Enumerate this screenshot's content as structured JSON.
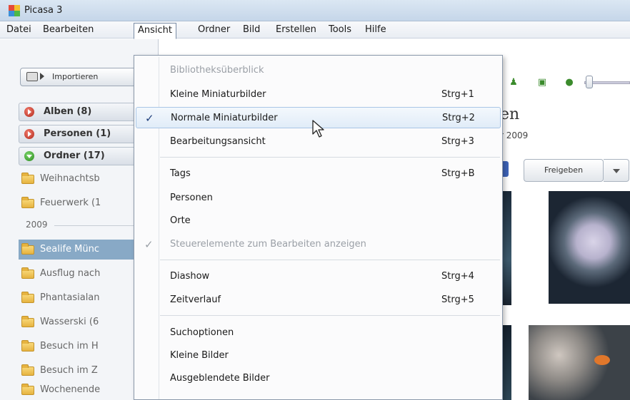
{
  "window": {
    "title": "Picasa 3"
  },
  "menubar": {
    "items": [
      "Datei",
      "Bearbeiten",
      "Ansicht",
      "Ordner",
      "Bild",
      "Erstellen",
      "Tools",
      "Hilfe"
    ]
  },
  "left_panel": {
    "import_label": "Importieren",
    "sections": [
      "Alben (8)",
      "Personen (1)",
      "Ordner (17)"
    ],
    "folders_before_year": [
      "Weihnachtsb",
      "Feuerwerk (1"
    ],
    "year": "2009",
    "folders_after_year": [
      "Sealife Münc",
      "Ausflug nach",
      "Phantasialan",
      "Wasserski (6",
      "Besuch im H",
      "Besuch im Z",
      "Wochenende"
    ],
    "selected_folder": "Sealife Münc"
  },
  "content": {
    "title_fragment": "en",
    "date_fragment": "r 2009",
    "share_label": "Freigeben"
  },
  "dropdown": {
    "items": [
      {
        "label": "Bibliotheksüberblick",
        "shortcut": "",
        "checked": false,
        "disabled": true
      },
      {
        "label": "Kleine Miniaturbilder",
        "shortcut": "Strg+1",
        "checked": false,
        "disabled": false
      },
      {
        "label": "Normale Miniaturbilder",
        "shortcut": "Strg+2",
        "checked": true,
        "disabled": false
      },
      {
        "label": "Bearbeitungsansicht",
        "shortcut": "Strg+3",
        "checked": false,
        "disabled": false
      },
      {
        "label": "Tags",
        "shortcut": "Strg+B",
        "checked": false,
        "disabled": false
      },
      {
        "label": "Personen",
        "shortcut": "",
        "checked": false,
        "disabled": false
      },
      {
        "label": "Orte",
        "shortcut": "",
        "checked": false,
        "disabled": false
      },
      {
        "label": "Steuerelemente zum Bearbeiten anzeigen",
        "shortcut": "",
        "checked": true,
        "disabled": true
      },
      {
        "label": "Diashow",
        "shortcut": "Strg+4",
        "checked": false,
        "disabled": false
      },
      {
        "label": "Zeitverlauf",
        "shortcut": "Strg+5",
        "checked": false,
        "disabled": false
      },
      {
        "label": "Suchoptionen",
        "shortcut": "",
        "checked": false,
        "disabled": false
      },
      {
        "label": "Kleine Bilder",
        "shortcut": "",
        "checked": false,
        "disabled": false
      },
      {
        "label": "Ausgeblendete Bilder",
        "shortcut": "",
        "checked": false,
        "disabled": false
      }
    ],
    "hovered": "Normale Miniaturbilder",
    "check_glyph": "✓"
  },
  "colors": {
    "selected_folder": "#88a9c6",
    "menu_hover_border": "#a9c6e6",
    "accent_blue": "#3e64b8"
  },
  "icons": {
    "app": "picasa-logo-icon",
    "cursor": "mouse-pointer-icon",
    "section_closed": "expand-arrow-icon",
    "section_open": "collapse-arrow-icon",
    "folder": "folder-icon"
  }
}
